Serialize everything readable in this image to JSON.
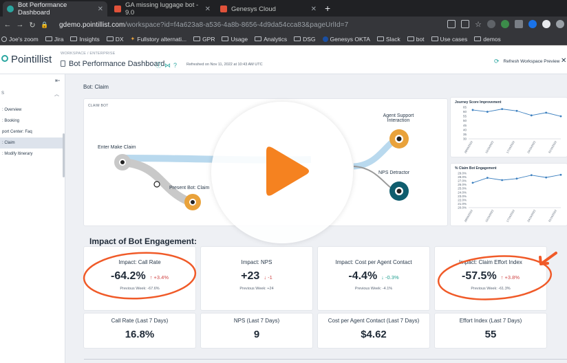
{
  "browser": {
    "tabs": [
      {
        "title": "Bot Performance Dashboard",
        "active": true
      },
      {
        "title": "GA missing luggage bot - 9.0",
        "active": false
      },
      {
        "title": "Genesys Cloud",
        "active": false
      }
    ],
    "url_host": "gdemo.pointillist.com",
    "url_path": "/workspace?id=f4a623a8-a536-4a8b-8656-4d9da54cca83&pageUrlId=7",
    "bookmarks": [
      "Joe's zoom",
      "Jira",
      "Insights",
      "DX",
      "Fullstory alternati...",
      "GPR",
      "Usage",
      "Analytics",
      "DSG",
      "Genesys OKTA",
      "Slack",
      "bot",
      "Use cases",
      "demos"
    ]
  },
  "header": {
    "logo_text": "Pointillist",
    "breadcrumb": "WORKSPACE  /  ENTERPRISE",
    "title": "Bot Performance Dashboard",
    "refreshed": "Refreshed on Nov 11, 2022 at 10:43 AM UTC",
    "refresh_action": "Refresh Workspace Preview"
  },
  "sidebar": {
    "heading": "S",
    "items": [
      {
        "label": ": Overview",
        "selected": false
      },
      {
        "label": ": Booking",
        "selected": false
      },
      {
        "label": "port Center: Faq",
        "selected": false
      },
      {
        "label": ": Claim",
        "selected": true
      },
      {
        "label": ": Modify Itinerary",
        "selected": false
      }
    ]
  },
  "main": {
    "section_title": "Bot: Claim",
    "journey": {
      "label": "CLAIM BOT",
      "nodes": [
        "Enter Make Claim",
        "Present Bot: Claim",
        "Agent Support Interaction",
        "NPS Detractor"
      ]
    },
    "impact_title": "Impact of Bot Engagement:",
    "kpis": [
      {
        "title": "Impact: Call Rate",
        "value": "-64.2%",
        "delta": "+3.4%",
        "arrow": "↑",
        "tone": "red",
        "prev": "Previous Week: -67.6%"
      },
      {
        "title": "Impact: NPS",
        "value": "+23",
        "delta": "-1",
        "arrow": "↓",
        "tone": "red",
        "prev": "Previous Week: +24"
      },
      {
        "title": "Impact: Cost per Agent Contact",
        "value": "-4.4%",
        "delta": "-0.3%",
        "arrow": "↓",
        "tone": "green",
        "prev": "Previous Week: -4.1%"
      },
      {
        "title": "Impact: Claim Effort Index",
        "value": "-57.5%",
        "delta": "+3.8%",
        "arrow": "↑",
        "tone": "red",
        "prev": "Previous Week: -61.3%"
      }
    ],
    "stats": [
      {
        "title": "Call Rate (Last 7 Days)",
        "value": "16.8%"
      },
      {
        "title": "NPS (Last 7 Days)",
        "value": "9"
      },
      {
        "title": "Cost per Agent Contact (Last 7 Days)",
        "value": "$4.62"
      },
      {
        "title": "Effort Index (Last 7 Days)",
        "value": "55"
      }
    ]
  },
  "chart_data": [
    {
      "type": "line",
      "title": "Journey Score Improvement",
      "x": [
        "28/09/2022",
        "10/10/2022",
        "17/10/2022",
        "24/10/2022",
        "31/10/2022"
      ],
      "yticks": [
        "65",
        "60",
        "55",
        "50",
        "45",
        "40",
        "35",
        "30"
      ],
      "series": [
        {
          "values": [
            62,
            60,
            63,
            61,
            56,
            59,
            55
          ]
        }
      ],
      "ylim": [
        30,
        65
      ]
    },
    {
      "type": "line",
      "title": "% Claim Bot Engagement",
      "x": [
        "28/09/2022",
        "10/10/2022",
        "17/10/2022",
        "24/10/2022",
        "31/10/2022"
      ],
      "yticks": [
        "29.0%",
        "28.0%",
        "27.0%",
        "26.0%",
        "25.0%",
        "24.0%",
        "23.0%",
        "22.0%",
        "21.0%",
        "20.0%"
      ],
      "series": [
        {
          "values": [
            26.5,
            27.8,
            27.2,
            27.6,
            28.5,
            27.9,
            28.6
          ]
        }
      ],
      "ylim": [
        20,
        29
      ]
    }
  ],
  "colors": {
    "brand_teal": "#2aa6a0",
    "brand_orange": "#f08a24",
    "annotation": "#f05a28",
    "play": "#f58220"
  }
}
